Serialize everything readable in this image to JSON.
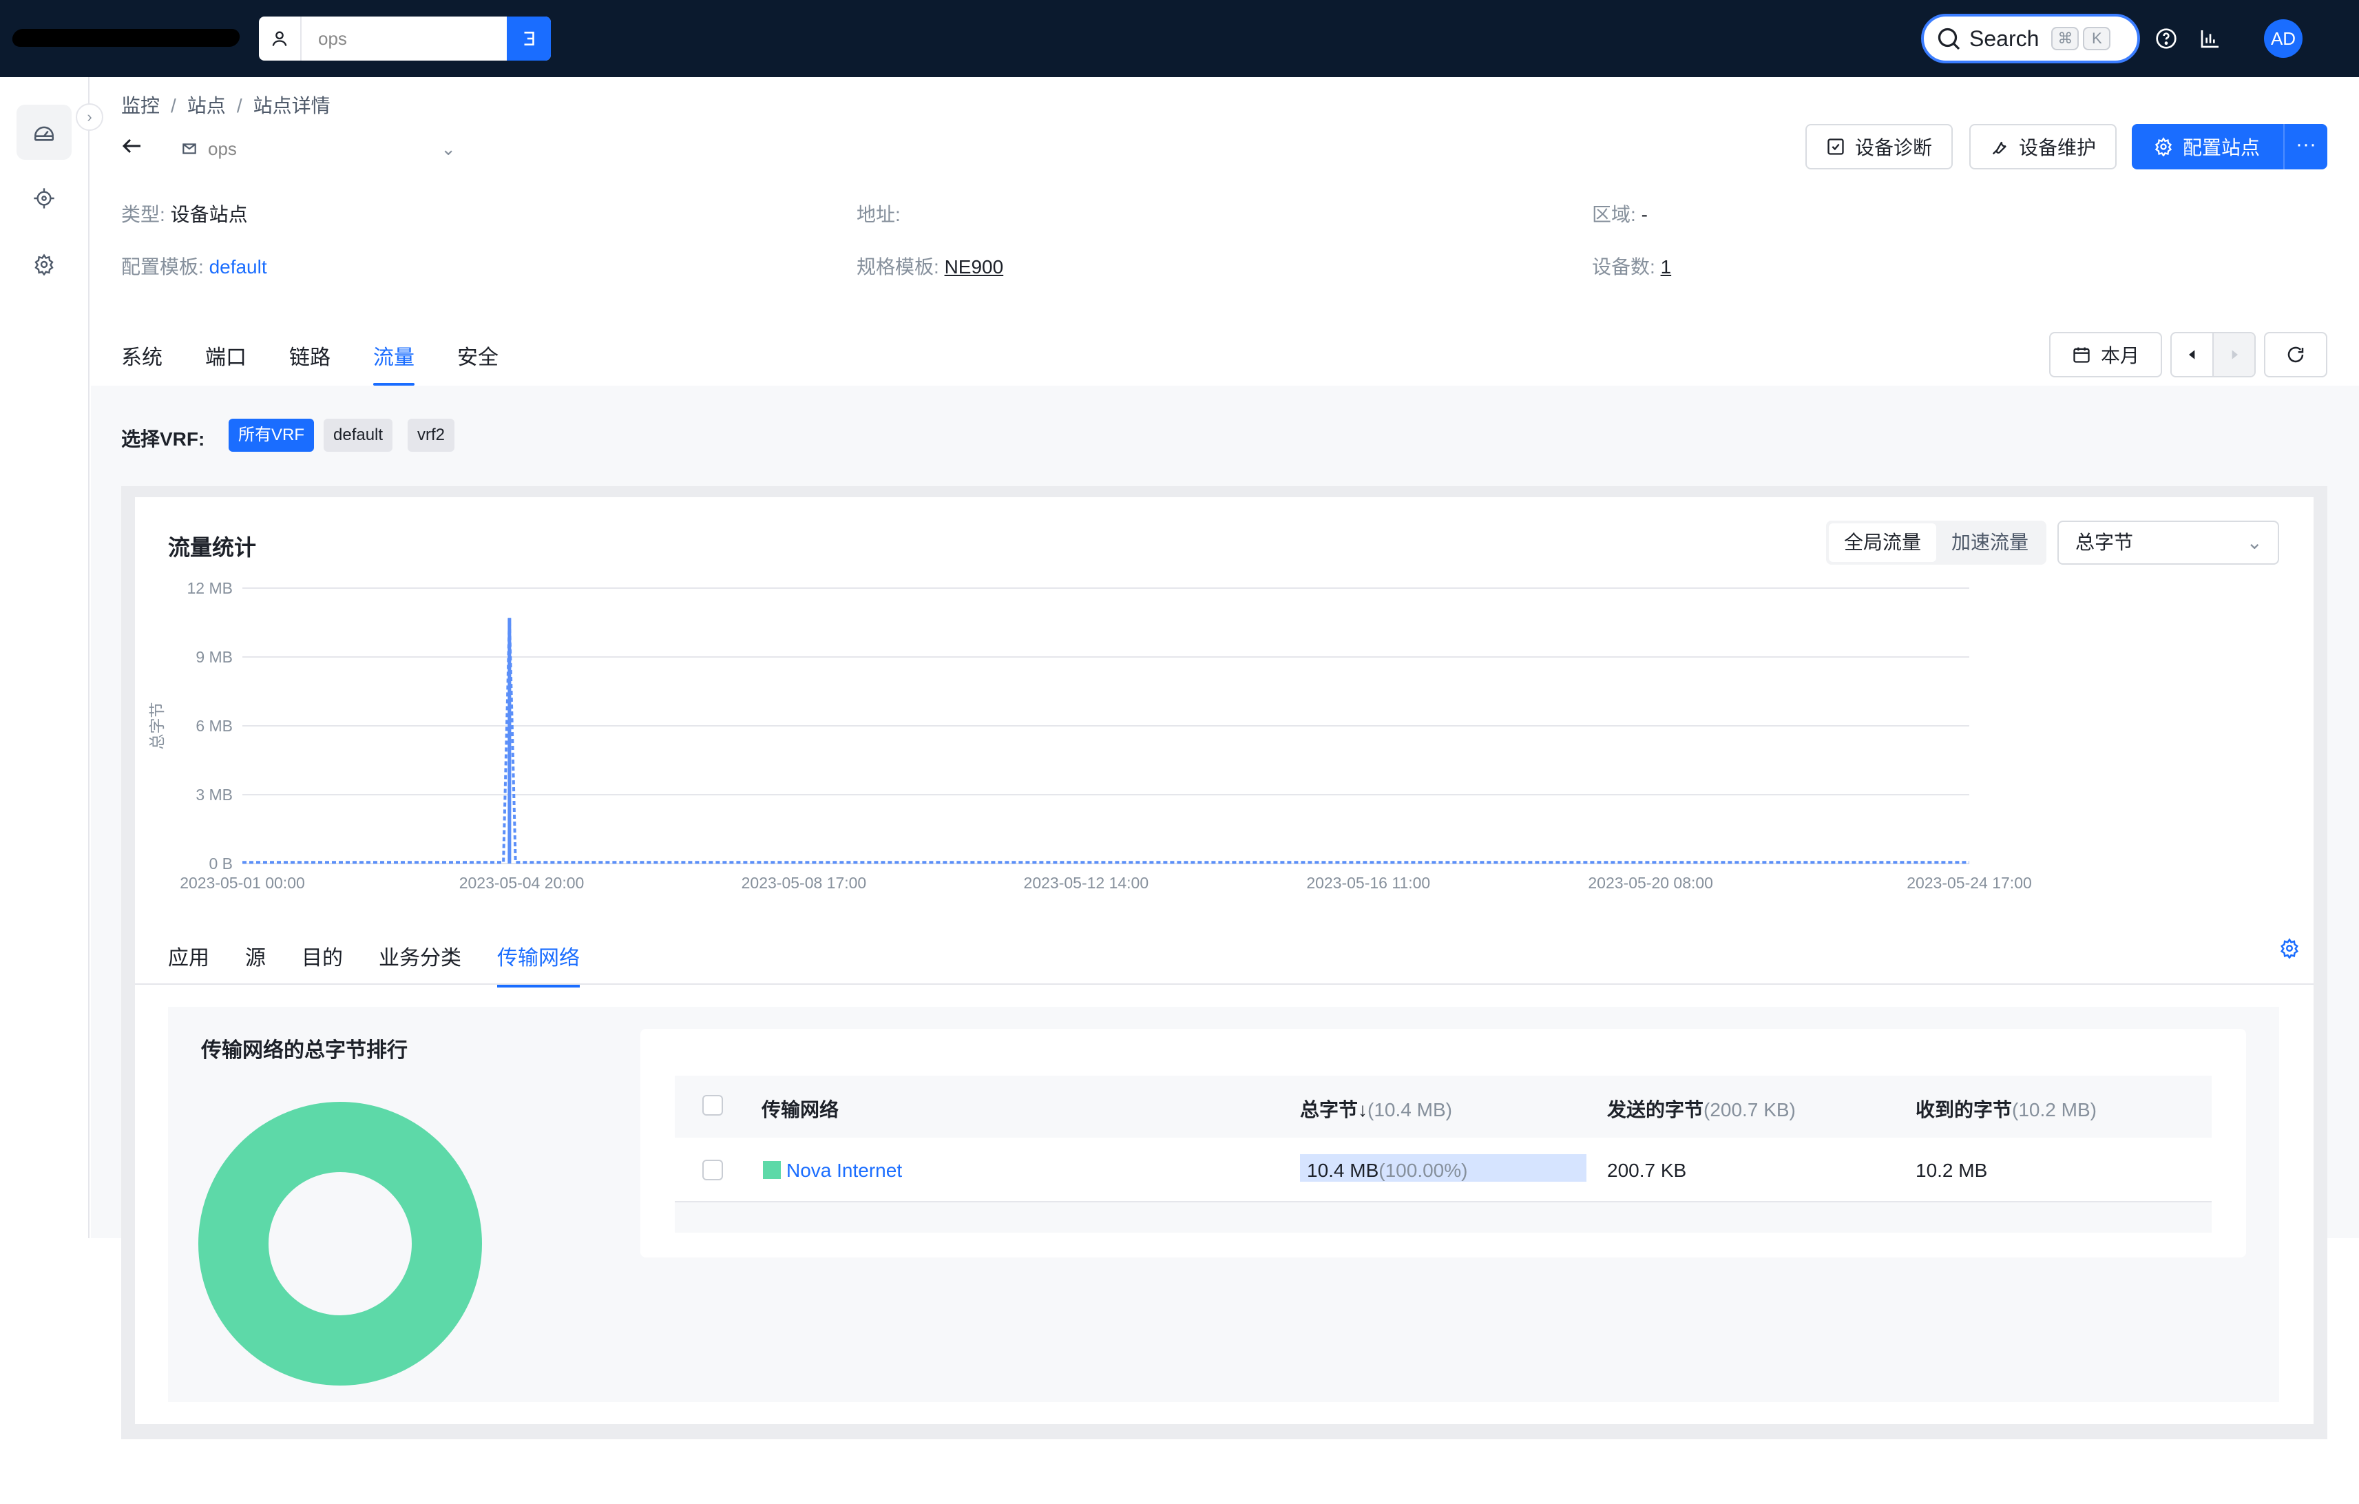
{
  "topbar": {
    "org_value": "ops",
    "search_label": "Search",
    "search_kbd1": "⌘",
    "search_kbd2": "K",
    "avatar_initials": "AD"
  },
  "breadcrumb": [
    "监控",
    "站点",
    "站点详情"
  ],
  "site": {
    "name": "ops"
  },
  "header_actions": {
    "diagnose": "设备诊断",
    "maintain": "设备维护",
    "configure": "配置站点",
    "more": "···"
  },
  "info": {
    "type_key": "类型:",
    "type_val": "设备站点",
    "addr_key": "地址:",
    "region_key": "区域:",
    "region_val": "-",
    "template_key": "配置模板:",
    "template_val": "default",
    "spec_key": "规格模板:",
    "spec_val": "NE900",
    "device_count_key": "设备数:",
    "device_count_val": "1"
  },
  "tabs": [
    "系统",
    "端口",
    "链路",
    "流量",
    "安全"
  ],
  "active_tab": "流量",
  "date_range_label": "本月",
  "vrf": {
    "label": "选择VRF:",
    "options": [
      "所有VRF",
      "default",
      "vrf2"
    ],
    "selected": "所有VRF"
  },
  "traffic_panel": {
    "title": "流量统计",
    "scope_options": [
      "全局流量",
      "加速流量"
    ],
    "scope_selected": "全局流量",
    "metric_selected": "总字节"
  },
  "chart_data": {
    "type": "line",
    "title": "",
    "ylabel": "总字节",
    "ylim": [
      0,
      12
    ],
    "y_ticks": [
      "0 B",
      "3 MB",
      "6 MB",
      "9 MB",
      "12 MB"
    ],
    "x_ticks": [
      "2023-05-01 00:00",
      "2023-05-04 20:00",
      "2023-05-08 17:00",
      "2023-05-12 14:00",
      "2023-05-16 11:00",
      "2023-05-20 08:00",
      "2023-05-24 17:00"
    ],
    "series": [
      {
        "color": "#5b8ff9",
        "points": [
          {
            "x": "2023-05-01 00:00",
            "y": 0.05
          },
          {
            "x": "2023-05-04 14:00",
            "y": 0.05
          },
          {
            "x": "2023-05-04 16:00",
            "y": 10.7
          },
          {
            "x": "2023-05-04 18:00",
            "y": 0.05
          },
          {
            "x": "2023-05-24 17:00",
            "y": 0.05
          }
        ]
      }
    ]
  },
  "subtabs": [
    "应用",
    "源",
    "目的",
    "业务分类",
    "传输网络"
  ],
  "active_subtab": "传输网络",
  "ranking": {
    "title": "传输网络的总字节排行",
    "donut_color": "#5dd9a8",
    "columns": {
      "network": "传输网络",
      "total": "总字节",
      "total_sub": "(10.4 MB)",
      "sent": "发送的字节",
      "sent_sub": "(200.7 KB)",
      "recv": "收到的字节",
      "recv_sub": "(10.2 MB)"
    },
    "rows": [
      {
        "network": "Nova Internet",
        "total": "10.4 MB",
        "total_pct": "(100.00%)",
        "total_fraction": 1.0,
        "sent": "200.7 KB",
        "recv": "10.2 MB"
      }
    ]
  }
}
